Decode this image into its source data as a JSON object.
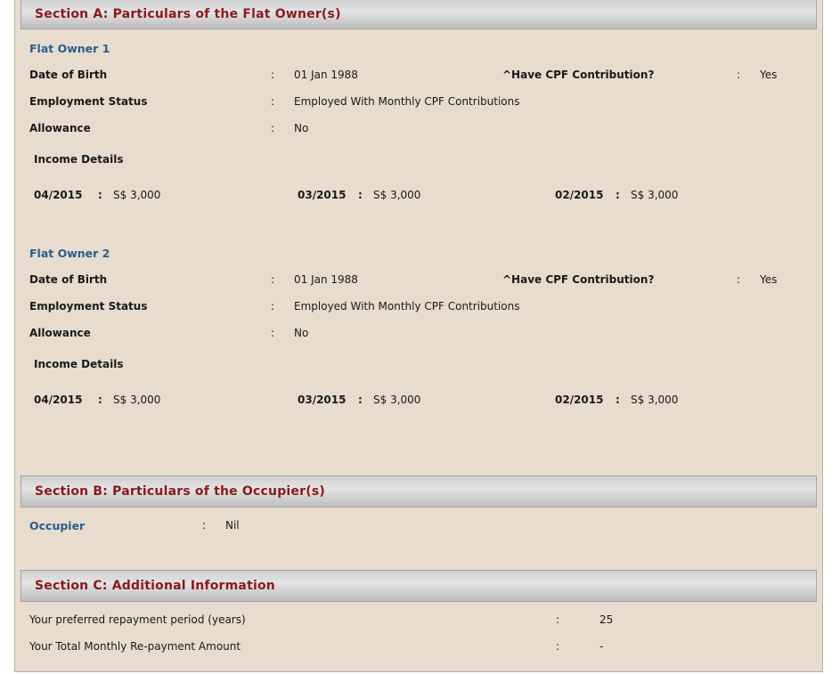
{
  "section_a": {
    "title": "Section A: Particulars of the Flat Owner(s)",
    "owners": [
      {
        "title": "Flat Owner 1",
        "dob_label": "Date of Birth",
        "dob_value": "01 Jan 1988",
        "cpf_label": "^Have CPF Contribution?",
        "cpf_value": "Yes",
        "employment_label": "Employment Status",
        "employment_value": "Employed With Monthly CPF Contributions",
        "allowance_label": "Allowance",
        "allowance_value": "No",
        "income_label": "Income Details",
        "income": [
          {
            "month": "04/2015",
            "amount": "S$ 3,000"
          },
          {
            "month": "03/2015",
            "amount": "S$ 3,000"
          },
          {
            "month": "02/2015",
            "amount": "S$ 3,000"
          }
        ]
      },
      {
        "title": "Flat Owner 2",
        "dob_label": "Date of Birth",
        "dob_value": "01 Jan 1988",
        "cpf_label": "^Have CPF Contribution?",
        "cpf_value": "Yes",
        "employment_label": "Employment Status",
        "employment_value": "Employed With Monthly CPF Contributions",
        "allowance_label": "Allowance",
        "allowance_value": "No",
        "income_label": "Income Details",
        "income": [
          {
            "month": "04/2015",
            "amount": "S$ 3,000"
          },
          {
            "month": "03/2015",
            "amount": "S$ 3,000"
          },
          {
            "month": "02/2015",
            "amount": "S$ 3,000"
          }
        ]
      }
    ]
  },
  "section_b": {
    "title": "Section B: Particulars of the Occupier(s)",
    "occupier_label": "Occupier",
    "occupier_value": "Nil"
  },
  "section_c": {
    "title": "Section C: Additional Information",
    "repayment_period_label": "Your preferred repayment period (years)",
    "repayment_period_value": "25",
    "monthly_repayment_label": "Your Total Monthly Re-payment Amount",
    "monthly_repayment_value": "-"
  },
  "separator": ":"
}
